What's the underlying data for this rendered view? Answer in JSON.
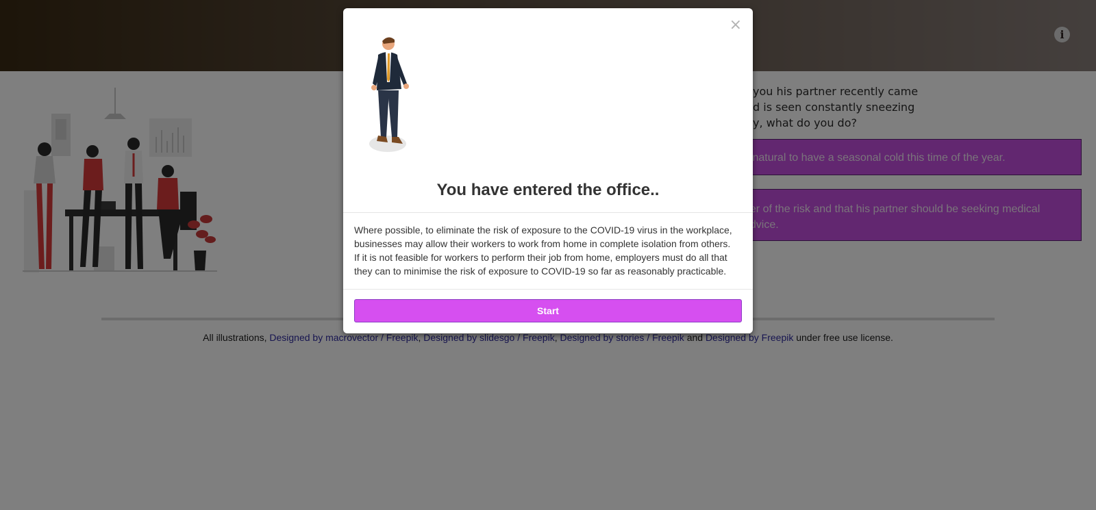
{
  "question": {
    "lines": [
      "you his partner recently came",
      "d is seen constantly sneezing",
      "y, what do you do?"
    ]
  },
  "answers": [
    {
      "lines": [
        "y natural to have a seasonal cold this time of the year."
      ]
    },
    {
      "lines": [
        "ger of the risk and that his partner should be seeking medical",
        "advice."
      ]
    }
  ],
  "credits": {
    "prefix": "All illustrations,",
    "link1": "Designed by macrovector / Freepik",
    "sep1": ",",
    "link2": "Designed by slidesgo / Freepik",
    "sep2": ",",
    "link3": "Designed by stories / Freepik",
    "sep3": "and",
    "link4": "Designed by Freepik",
    "suffix": "under free use license."
  },
  "modal": {
    "close_label": "×",
    "title": "You have entered the office..",
    "body_lines": [
      "Where possible, to eliminate the risk of exposure to the COVID-19 virus in the workplace,",
      "businesses may allow their workers to work from home in complete isolation from others.",
      "If it is not feasible for workers to perform their job from home, employers must do all that",
      "they can to minimise the risk of exposure to COVID-19 so far as reasonably practicable."
    ],
    "start_label": "Start"
  },
  "icons": {
    "info": "info-icon",
    "info_glyph": "i",
    "close": "close-icon"
  },
  "colors": {
    "accent": "#d64ff0",
    "answer_bg": "#c44ee0",
    "header_dark": "#3a2a14"
  }
}
